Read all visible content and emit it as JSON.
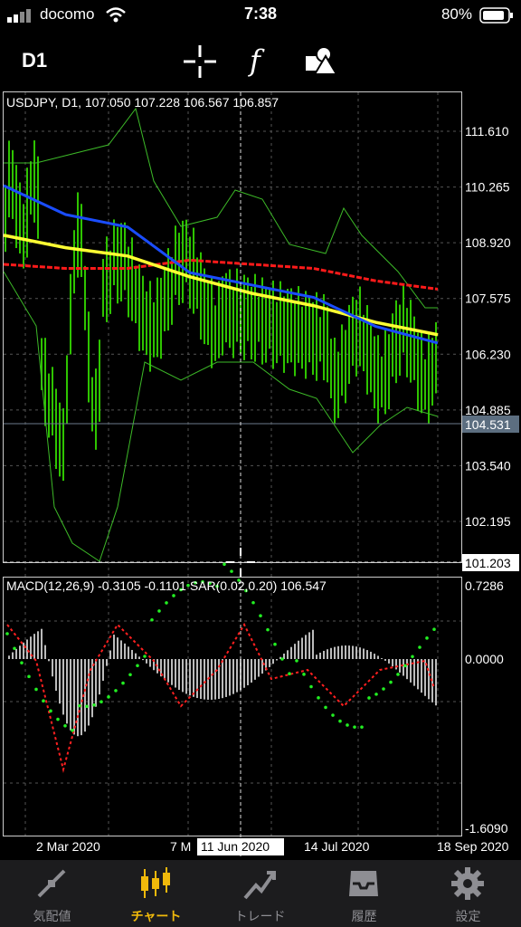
{
  "status_bar": {
    "carrier": "docomo",
    "time": "7:38",
    "battery": "80%"
  },
  "toolbar": {
    "timeframe": "D1",
    "icons": [
      "crosshair-icon",
      "function-icon",
      "objects-icon"
    ]
  },
  "chart": {
    "header": "USDJPY, D1, 107.050 107.228 106.567 106.857",
    "price_levels": [
      "111.610",
      "110.265",
      "108.920",
      "107.575",
      "106.230",
      "104.885",
      "103.540",
      "102.195"
    ],
    "price_values": [
      111.61,
      110.265,
      108.92,
      107.575,
      106.23,
      104.885,
      103.54,
      102.195
    ],
    "current_price": "104.531",
    "crosshair_price": "101.203",
    "date_labels": [
      "2 Mar 2020",
      "7 M",
      "14 Jul 2020",
      "18 Sep 2020"
    ],
    "crosshair_date": "11 Jun 2020",
    "macd_header": "MACD(12,26,9) -0.3105 -0.1101 SAR(0.02,0.20) 106.547",
    "macd_levels": [
      "0.7286",
      "0.0000",
      "-1.6090"
    ],
    "colors": {
      "price_bars": "#2ec400",
      "bollinger": "#3dba28",
      "sma_red": "#ff1a1a",
      "sma_yellow": "#ffff33",
      "ema_blue": "#1a4dff",
      "macd_signal": "#ff2020",
      "sar": "#22ee22",
      "histogram": "#bbbbbb",
      "accent": "#f0b90b"
    }
  },
  "chart_data": {
    "type": "line",
    "symbol": "USDJPY",
    "timeframe": "D1",
    "ohlc_last": {
      "open": 107.05,
      "high": 107.228,
      "low": 106.567,
      "close": 106.857
    },
    "x": [
      "2 Mar 2020",
      "11 Jun 2020",
      "14 Jul 2020",
      "18 Sep 2020"
    ],
    "series": [
      {
        "values": [
          110.3,
          109.6,
          109.3,
          108.2,
          107.9,
          107.6,
          106.9,
          106.5
        ]
      },
      {
        "values": [
          108.4,
          108.3,
          108.3,
          108.5,
          108.4,
          108.3,
          108.0,
          107.8
        ]
      },
      {
        "values": [
          109.1,
          108.8,
          108.6,
          108.1,
          107.7,
          107.4,
          107.0,
          106.7
        ]
      }
    ],
    "ylim": [
      101.203,
      112.3
    ],
    "macd": {
      "main": -0.3105,
      "signal": -0.1101,
      "ylim": [
        -1.609,
        0.7286
      ]
    },
    "sar": {
      "step": 0.02,
      "max": 0.2,
      "value": 106.547
    }
  },
  "tabs": [
    {
      "label": "気配値",
      "icon": "quotes-icon",
      "active": false
    },
    {
      "label": "チャート",
      "icon": "chart-icon",
      "active": true
    },
    {
      "label": "トレード",
      "icon": "trade-icon",
      "active": false
    },
    {
      "label": "履歴",
      "icon": "history-icon",
      "active": false
    },
    {
      "label": "設定",
      "icon": "settings-icon",
      "active": false
    }
  ]
}
